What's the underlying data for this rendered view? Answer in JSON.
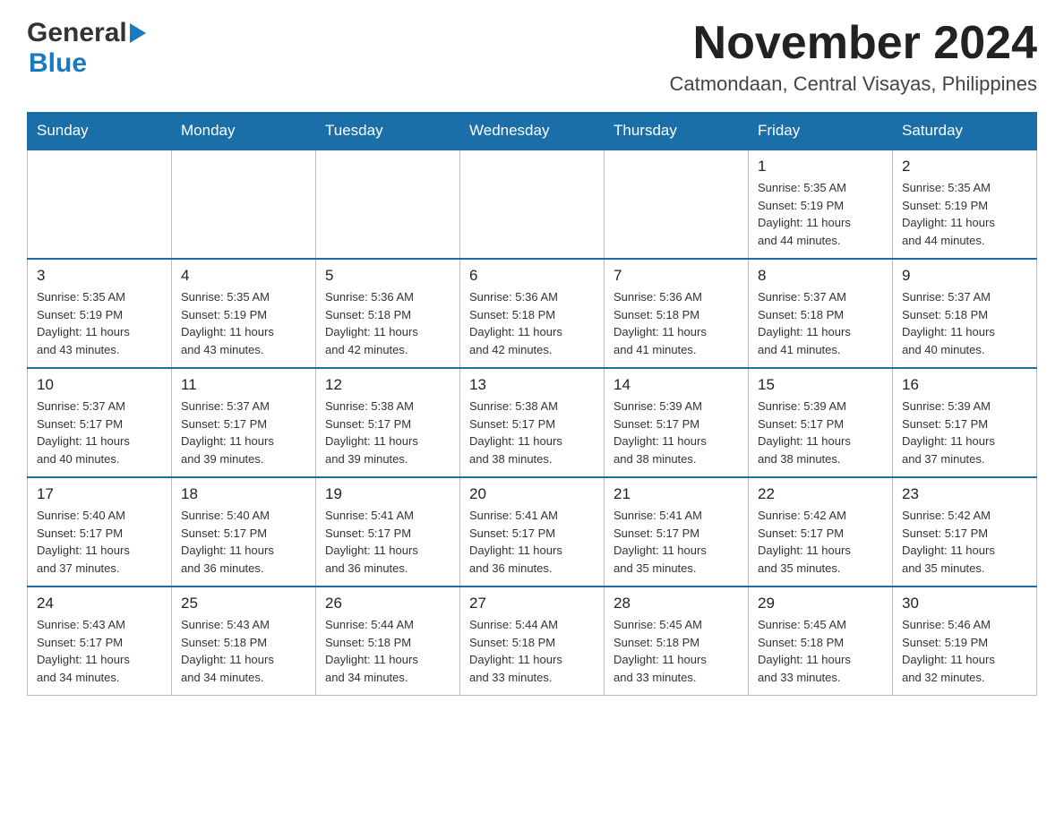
{
  "header": {
    "logo_general": "General",
    "logo_blue": "Blue",
    "month_title": "November 2024",
    "location": "Catmondaan, Central Visayas, Philippines"
  },
  "calendar": {
    "days_of_week": [
      "Sunday",
      "Monday",
      "Tuesday",
      "Wednesday",
      "Thursday",
      "Friday",
      "Saturday"
    ],
    "weeks": [
      [
        {
          "day": "",
          "info": ""
        },
        {
          "day": "",
          "info": ""
        },
        {
          "day": "",
          "info": ""
        },
        {
          "day": "",
          "info": ""
        },
        {
          "day": "",
          "info": ""
        },
        {
          "day": "1",
          "info": "Sunrise: 5:35 AM\nSunset: 5:19 PM\nDaylight: 11 hours\nand 44 minutes."
        },
        {
          "day": "2",
          "info": "Sunrise: 5:35 AM\nSunset: 5:19 PM\nDaylight: 11 hours\nand 44 minutes."
        }
      ],
      [
        {
          "day": "3",
          "info": "Sunrise: 5:35 AM\nSunset: 5:19 PM\nDaylight: 11 hours\nand 43 minutes."
        },
        {
          "day": "4",
          "info": "Sunrise: 5:35 AM\nSunset: 5:19 PM\nDaylight: 11 hours\nand 43 minutes."
        },
        {
          "day": "5",
          "info": "Sunrise: 5:36 AM\nSunset: 5:18 PM\nDaylight: 11 hours\nand 42 minutes."
        },
        {
          "day": "6",
          "info": "Sunrise: 5:36 AM\nSunset: 5:18 PM\nDaylight: 11 hours\nand 42 minutes."
        },
        {
          "day": "7",
          "info": "Sunrise: 5:36 AM\nSunset: 5:18 PM\nDaylight: 11 hours\nand 41 minutes."
        },
        {
          "day": "8",
          "info": "Sunrise: 5:37 AM\nSunset: 5:18 PM\nDaylight: 11 hours\nand 41 minutes."
        },
        {
          "day": "9",
          "info": "Sunrise: 5:37 AM\nSunset: 5:18 PM\nDaylight: 11 hours\nand 40 minutes."
        }
      ],
      [
        {
          "day": "10",
          "info": "Sunrise: 5:37 AM\nSunset: 5:17 PM\nDaylight: 11 hours\nand 40 minutes."
        },
        {
          "day": "11",
          "info": "Sunrise: 5:37 AM\nSunset: 5:17 PM\nDaylight: 11 hours\nand 39 minutes."
        },
        {
          "day": "12",
          "info": "Sunrise: 5:38 AM\nSunset: 5:17 PM\nDaylight: 11 hours\nand 39 minutes."
        },
        {
          "day": "13",
          "info": "Sunrise: 5:38 AM\nSunset: 5:17 PM\nDaylight: 11 hours\nand 38 minutes."
        },
        {
          "day": "14",
          "info": "Sunrise: 5:39 AM\nSunset: 5:17 PM\nDaylight: 11 hours\nand 38 minutes."
        },
        {
          "day": "15",
          "info": "Sunrise: 5:39 AM\nSunset: 5:17 PM\nDaylight: 11 hours\nand 38 minutes."
        },
        {
          "day": "16",
          "info": "Sunrise: 5:39 AM\nSunset: 5:17 PM\nDaylight: 11 hours\nand 37 minutes."
        }
      ],
      [
        {
          "day": "17",
          "info": "Sunrise: 5:40 AM\nSunset: 5:17 PM\nDaylight: 11 hours\nand 37 minutes."
        },
        {
          "day": "18",
          "info": "Sunrise: 5:40 AM\nSunset: 5:17 PM\nDaylight: 11 hours\nand 36 minutes."
        },
        {
          "day": "19",
          "info": "Sunrise: 5:41 AM\nSunset: 5:17 PM\nDaylight: 11 hours\nand 36 minutes."
        },
        {
          "day": "20",
          "info": "Sunrise: 5:41 AM\nSunset: 5:17 PM\nDaylight: 11 hours\nand 36 minutes."
        },
        {
          "day": "21",
          "info": "Sunrise: 5:41 AM\nSunset: 5:17 PM\nDaylight: 11 hours\nand 35 minutes."
        },
        {
          "day": "22",
          "info": "Sunrise: 5:42 AM\nSunset: 5:17 PM\nDaylight: 11 hours\nand 35 minutes."
        },
        {
          "day": "23",
          "info": "Sunrise: 5:42 AM\nSunset: 5:17 PM\nDaylight: 11 hours\nand 35 minutes."
        }
      ],
      [
        {
          "day": "24",
          "info": "Sunrise: 5:43 AM\nSunset: 5:17 PM\nDaylight: 11 hours\nand 34 minutes."
        },
        {
          "day": "25",
          "info": "Sunrise: 5:43 AM\nSunset: 5:18 PM\nDaylight: 11 hours\nand 34 minutes."
        },
        {
          "day": "26",
          "info": "Sunrise: 5:44 AM\nSunset: 5:18 PM\nDaylight: 11 hours\nand 34 minutes."
        },
        {
          "day": "27",
          "info": "Sunrise: 5:44 AM\nSunset: 5:18 PM\nDaylight: 11 hours\nand 33 minutes."
        },
        {
          "day": "28",
          "info": "Sunrise: 5:45 AM\nSunset: 5:18 PM\nDaylight: 11 hours\nand 33 minutes."
        },
        {
          "day": "29",
          "info": "Sunrise: 5:45 AM\nSunset: 5:18 PM\nDaylight: 11 hours\nand 33 minutes."
        },
        {
          "day": "30",
          "info": "Sunrise: 5:46 AM\nSunset: 5:19 PM\nDaylight: 11 hours\nand 32 minutes."
        }
      ]
    ]
  }
}
